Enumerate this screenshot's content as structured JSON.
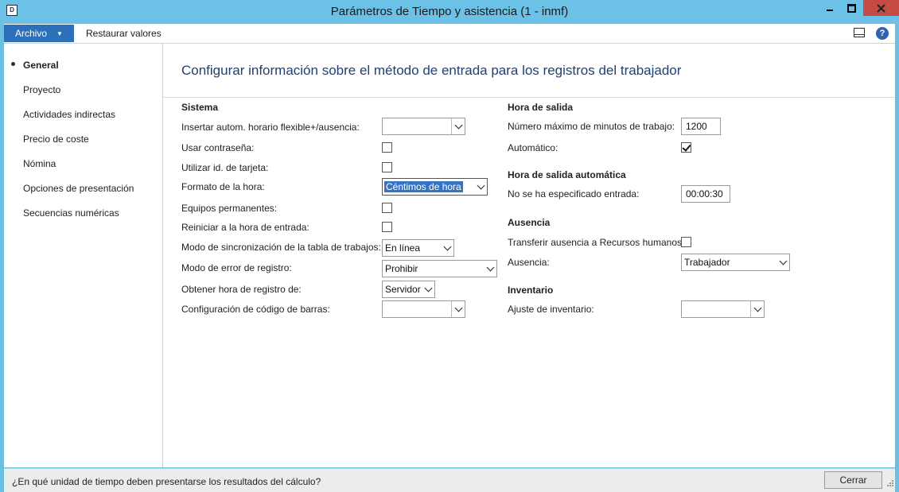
{
  "window": {
    "title": "Parámetros de Tiempo y asistencia (1 - inmf)",
    "app_icon_text": "D"
  },
  "menubar": {
    "file_label": "Archivo",
    "restore_label": "Restaurar valores"
  },
  "nav": {
    "items": [
      {
        "label": "General",
        "active": true
      },
      {
        "label": "Proyecto"
      },
      {
        "label": "Actividades indirectas"
      },
      {
        "label": "Precio de coste"
      },
      {
        "label": "Nómina"
      },
      {
        "label": "Opciones de presentación"
      },
      {
        "label": "Secuencias numéricas"
      }
    ]
  },
  "main": {
    "heading": "Configurar información sobre el método de entrada para los registros del trabajador",
    "sistema": {
      "title": "Sistema",
      "fields": [
        {
          "label": "Insertar autom. horario flexible+/ausencia:",
          "type": "combo",
          "value": ""
        },
        {
          "label": "Usar contraseña:",
          "type": "checkbox",
          "checked": false
        },
        {
          "label": "Utilizar id. de tarjeta:",
          "type": "checkbox",
          "checked": false
        },
        {
          "label": "Formato de la hora:",
          "type": "combo",
          "value": "Céntimos de hora"
        },
        {
          "label": "Equipos permanentes:",
          "type": "checkbox",
          "checked": false
        },
        {
          "label": "Reiniciar a la hora de entrada:",
          "type": "checkbox",
          "checked": false
        },
        {
          "label": "Modo de sincronización de la tabla de trabajos:",
          "type": "combo",
          "value": "En línea"
        },
        {
          "label": "Modo de error de registro:",
          "type": "combo",
          "value": "Prohibir"
        },
        {
          "label": "Obtener hora de registro de:",
          "type": "combo",
          "value": "Servidor"
        },
        {
          "label": "Configuración de código de barras:",
          "type": "combo",
          "value": ""
        }
      ]
    },
    "hora_salida": {
      "title": "Hora de salida",
      "max_minutes_label": "Número máximo de minutos de trabajo:",
      "max_minutes_value": "1200",
      "automatic_label": "Automático:",
      "automatic_checked": true
    },
    "hora_salida_auto": {
      "title": "Hora de salida automática",
      "no_entry_label": "No se ha especificado entrada:",
      "no_entry_value": "00:00:30"
    },
    "ausencia": {
      "title": "Ausencia",
      "transfer_label": "Transferir ausencia a Recursos humanos:",
      "transfer_checked": false,
      "absence_label": "Ausencia:",
      "absence_value": "Trabajador"
    },
    "inventario": {
      "title": "Inventario",
      "adjust_label": "Ajuste de inventario:",
      "adjust_value": ""
    }
  },
  "status": {
    "help_text": "¿En qué unidad de tiempo deben presentarse los resultados del cálculo?",
    "close_label": "Cerrar"
  }
}
